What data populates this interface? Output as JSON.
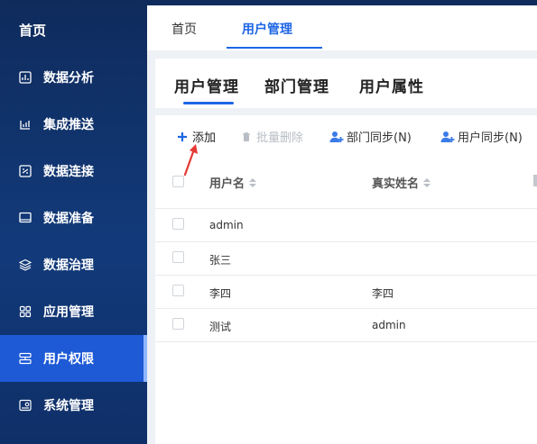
{
  "sidebar": {
    "home": "首页",
    "items": [
      {
        "label": "数据分析",
        "icon": "chart-icon"
      },
      {
        "label": "集成推送",
        "icon": "push-icon"
      },
      {
        "label": "数据连接",
        "icon": "connection-icon"
      },
      {
        "label": "数据准备",
        "icon": "monitor-icon"
      },
      {
        "label": "数据治理",
        "icon": "layers-icon"
      },
      {
        "label": "应用管理",
        "icon": "apps-icon"
      },
      {
        "label": "用户权限",
        "icon": "user-permission-icon",
        "active": true
      },
      {
        "label": "系统管理",
        "icon": "system-icon"
      }
    ]
  },
  "top_tabs": [
    {
      "label": "首页"
    },
    {
      "label": "用户管理",
      "active": true
    }
  ],
  "sub_tabs": [
    {
      "label": "用户管理",
      "active": true
    },
    {
      "label": "部门管理"
    },
    {
      "label": "用户属性"
    }
  ],
  "toolbar": {
    "add": "添加",
    "batch_delete": "批量删除",
    "dept_sync": "部门同步(N)",
    "user_sync": "用户同步(N)"
  },
  "table": {
    "columns": [
      "用户名",
      "真实姓名"
    ],
    "rows": [
      {
        "username": "admin",
        "realname": ""
      },
      {
        "username": "张三",
        "realname": ""
      },
      {
        "username": "李四",
        "realname": "李四"
      },
      {
        "username": "测试",
        "realname": "admin"
      }
    ]
  },
  "colors": {
    "sidebar_bg": "#0f2b5c",
    "sidebar_active": "#1e5ad6",
    "accent": "#1e66e5",
    "annotation": "#e53935"
  }
}
